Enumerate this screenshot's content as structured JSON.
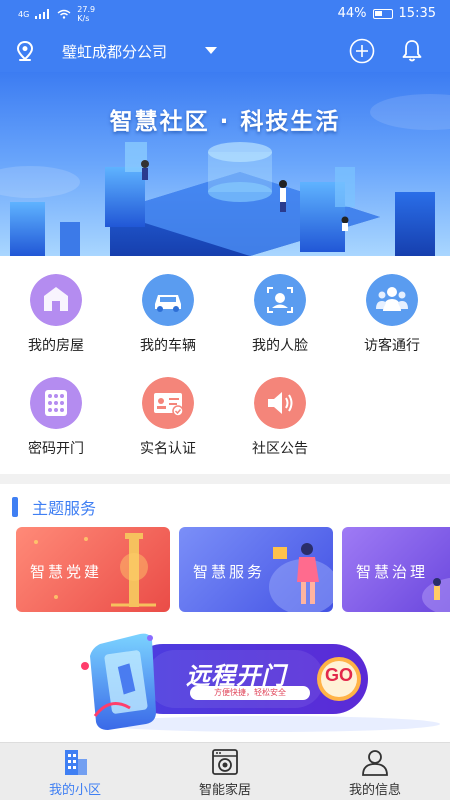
{
  "status_bar": {
    "network": "4G",
    "speed": "27.9",
    "speed_unit": "K/s",
    "battery": "44%",
    "time": "15:35"
  },
  "header": {
    "company": "璧虹成都分公司",
    "location_icon": "location-pin-icon",
    "add_icon": "plus-circle-icon",
    "bell_icon": "bell-icon"
  },
  "banner": {
    "title": "智慧社区 · 科技生活"
  },
  "grid": {
    "items": [
      {
        "label": "我的房屋",
        "icon": "house-icon",
        "color": "#a77ae8"
      },
      {
        "label": "我的车辆",
        "icon": "car-icon",
        "color": "#4a90e8"
      },
      {
        "label": "我的人脸",
        "icon": "face-scan-icon",
        "color": "#4a90e8"
      },
      {
        "label": "访客通行",
        "icon": "visitors-icon",
        "color": "#4a90e8"
      },
      {
        "label": "密码开门",
        "icon": "keypad-icon",
        "color": "#a77ae8"
      },
      {
        "label": "实名认证",
        "icon": "id-card-icon",
        "color": "#f07a6a"
      },
      {
        "label": "社区公告",
        "icon": "speaker-icon",
        "color": "#f07a6a"
      }
    ]
  },
  "theme_section": {
    "title": "主题服务",
    "cards": [
      {
        "label": "智慧党建",
        "color": "#ef6558"
      },
      {
        "label": "智慧服务",
        "color": "#5b6ef2"
      },
      {
        "label": "智慧治理",
        "color": "#7b55e6"
      }
    ]
  },
  "remote_open": {
    "title": "远程开门",
    "subtitle": "方便快捷，轻松安全",
    "go_label": "GO"
  },
  "bottom_nav": {
    "items": [
      {
        "label": "我的小区",
        "icon": "community-building-icon",
        "active": true
      },
      {
        "label": "智能家居",
        "icon": "washing-machine-icon",
        "active": false
      },
      {
        "label": "我的信息",
        "icon": "person-icon",
        "active": false
      }
    ]
  },
  "colors": {
    "primary": "#3f7ff3",
    "background": "#ffffff",
    "nav_bg": "#ececec"
  }
}
